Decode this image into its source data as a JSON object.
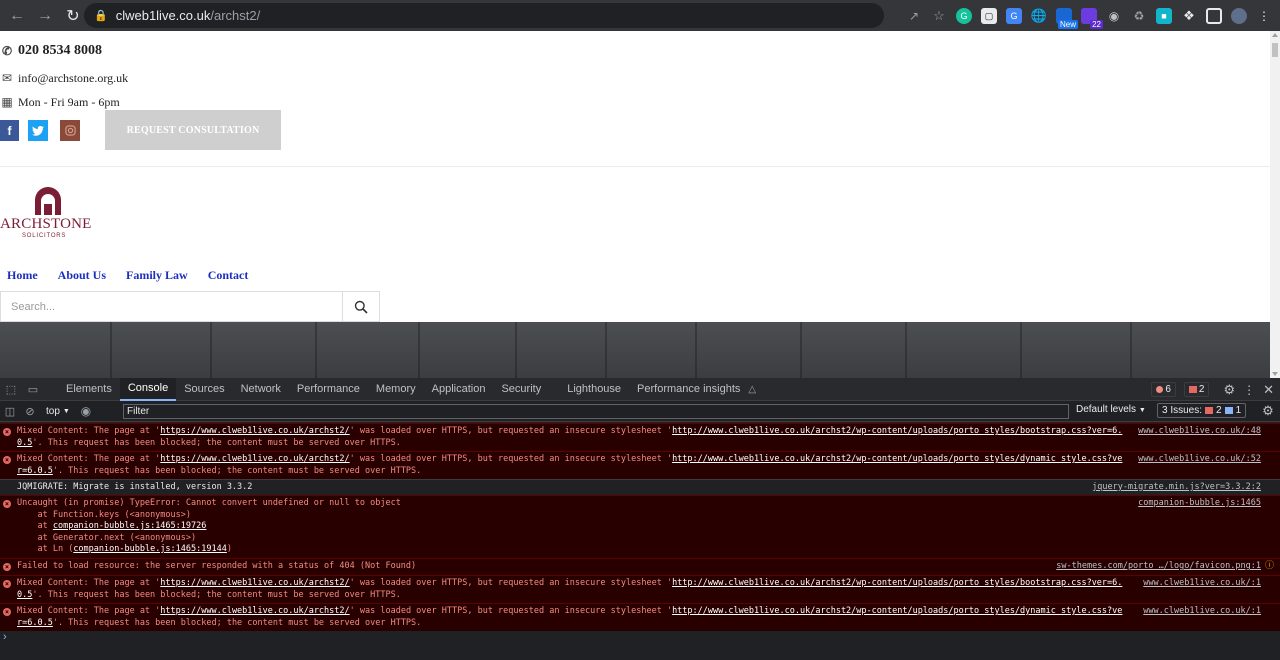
{
  "browser": {
    "host": "clweb1live.co.uk",
    "path": "/archst2/",
    "ext_badge_new": "New",
    "ext_badge_count": "22"
  },
  "site": {
    "phone": "020 8534 8008",
    "email": "info@archstone.org.uk",
    "hours": "Mon - Fri 9am - 6pm",
    "consult_button": "REQUEST CONSULTATION",
    "logo_word": "ARCHSTONE",
    "logo_sub": "SOLICITORS",
    "menu": [
      "Home",
      "About Us",
      "Family Law",
      "Contact"
    ],
    "search_placeholder": "Search..."
  },
  "devtools": {
    "tabs": [
      "Elements",
      "Console",
      "Sources",
      "Network",
      "Performance",
      "Memory",
      "Application",
      "Security",
      "Lighthouse",
      "Performance insights"
    ],
    "active_tab": "Console",
    "error_count": "6",
    "warning_count": "2",
    "context": "top",
    "filter_placeholder": "Filter",
    "levels": "Default levels",
    "issues_label": "3 Issues:",
    "issues_red": "2",
    "issues_blue": "1",
    "logs": [
      {
        "type": "error",
        "pre": "Mixed Content: The page at '",
        "link1": "https://www.clweb1live.co.uk/archst2/",
        "mid": "' was loaded over HTTPS, but requested an insecure stylesheet '",
        "link2": "http://www.clweb1live.co.uk/archst2/wp-content/uploads/porto_styles/bootstrap.css?ver=6.0.5",
        "post": "'. This request has been blocked; the content must be served over HTTPS.",
        "source": "www.clweb1live.co.uk/:48"
      },
      {
        "type": "error",
        "pre": "Mixed Content: The page at '",
        "link1": "https://www.clweb1live.co.uk/archst2/",
        "mid": "' was loaded over HTTPS, but requested an insecure stylesheet '",
        "link2": "http://www.clweb1live.co.uk/archst2/wp-content/uploads/porto_styles/dynamic_style.css?ver=6.0.5",
        "post": "'. This request has been blocked; the content must be served over HTTPS.",
        "source": "www.clweb1live.co.uk/:52"
      },
      {
        "type": "info",
        "text": "JQMIGRATE: Migrate is installed, version 3.3.2",
        "source": "jquery-migrate.min.js?ver=3.3.2:2"
      },
      {
        "type": "error",
        "line1": "Uncaught (in promise) TypeError: Cannot convert undefined or null to object",
        "line2": "    at Function.keys (<anonymous>)",
        "line3a": "    at ",
        "line3b": "companion-bubble.js:1465:19726",
        "line4": "    at Generator.next (<anonymous>)",
        "line5a": "    at Ln (",
        "line5b": "companion-bubble.js:1465:19144",
        "line5c": ")",
        "source": "companion-bubble.js:1465"
      },
      {
        "type": "error",
        "text": "Failed to load resource: the server responded with a status of 404 (Not Found)",
        "source": "sw-themes.com/porto …/logo/favicon.png:1"
      },
      {
        "type": "error",
        "pre": "Mixed Content: The page at '",
        "link1": "https://www.clweb1live.co.uk/archst2/",
        "mid": "' was loaded over HTTPS, but requested an insecure stylesheet '",
        "link2": "http://www.clweb1live.co.uk/archst2/wp-content/uploads/porto_styles/bootstrap.css?ver=6.0.5",
        "post": "'. This request has been blocked; the content must be served over HTTPS.",
        "source": "www.clweb1live.co.uk/:1"
      },
      {
        "type": "error",
        "pre": "Mixed Content: The page at '",
        "link1": "https://www.clweb1live.co.uk/archst2/",
        "mid": "' was loaded over HTTPS, but requested an insecure stylesheet '",
        "link2": "http://www.clweb1live.co.uk/archst2/wp-content/uploads/porto_styles/dynamic_style.css?ver=6.0.5",
        "post": "'. This request has been blocked; the content must be served over HTTPS.",
        "source": "www.clweb1live.co.uk/:1"
      }
    ],
    "prompt": "›"
  }
}
